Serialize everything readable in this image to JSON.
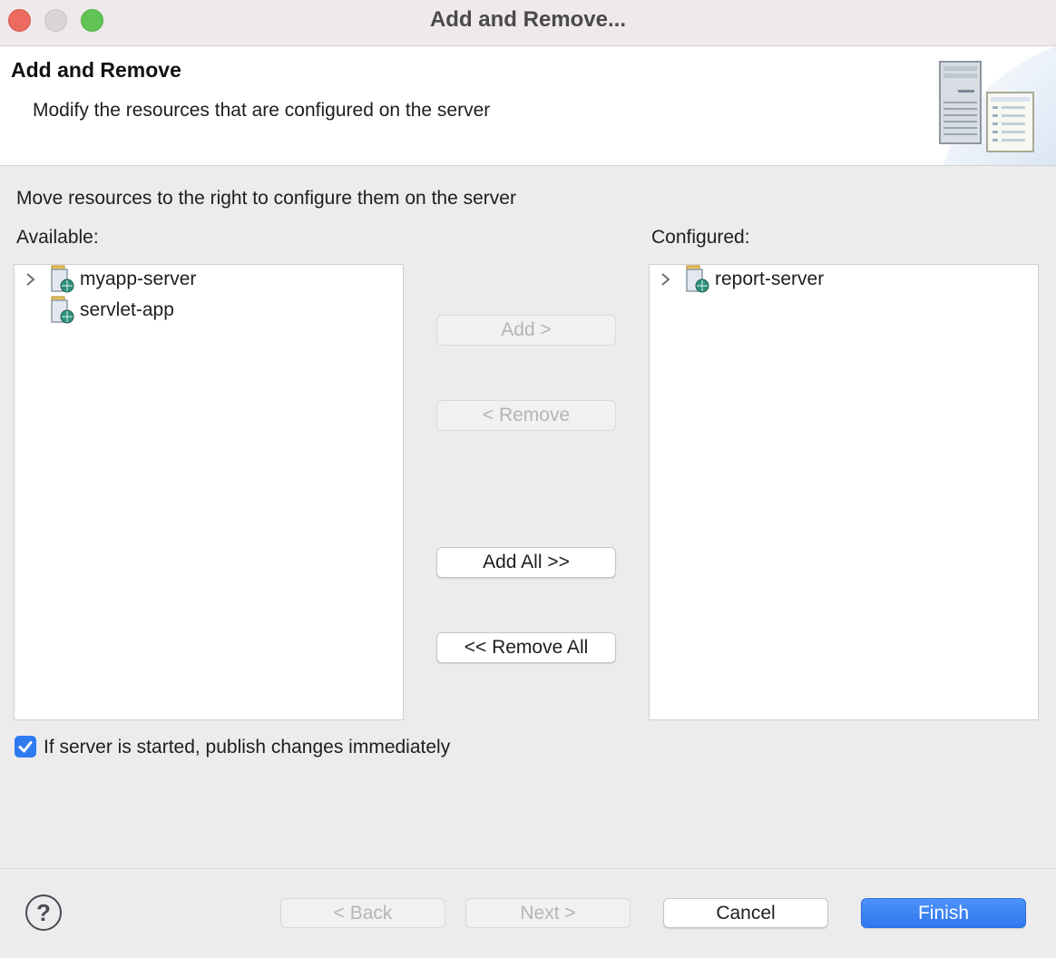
{
  "window": {
    "title": "Add and Remove..."
  },
  "banner": {
    "title": "Add and Remove",
    "description": "Modify the resources that are configured on the server"
  },
  "instruction": "Move resources to the right to configure them on the server",
  "available": {
    "label": "Available:",
    "items": [
      {
        "label": "myapp-server",
        "expandable": true
      },
      {
        "label": "servlet-app",
        "expandable": false
      }
    ]
  },
  "configured": {
    "label": "Configured:",
    "items": [
      {
        "label": "report-server",
        "expandable": true
      }
    ]
  },
  "transfer_buttons": {
    "add": "Add >",
    "remove": "< Remove",
    "add_all": "Add All >>",
    "remove_all": "<< Remove All"
  },
  "publish_option": {
    "label": "If server is started, publish changes immediately",
    "checked": true
  },
  "footer": {
    "help": "?",
    "back": "< Back",
    "next": "Next >",
    "cancel": "Cancel",
    "finish": "Finish"
  },
  "colors": {
    "accent": "#3b82f6",
    "close": "#ec6a5f",
    "maximize": "#61c454"
  }
}
